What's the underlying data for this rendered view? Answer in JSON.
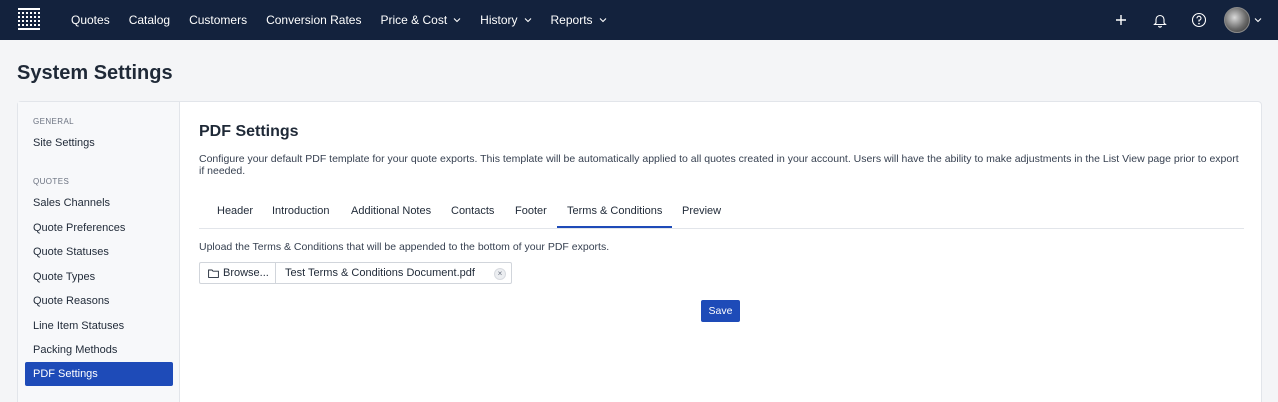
{
  "nav": {
    "items": [
      {
        "label": "Quotes",
        "dropdown": false
      },
      {
        "label": "Catalog",
        "dropdown": false
      },
      {
        "label": "Customers",
        "dropdown": false
      },
      {
        "label": "Conversion Rates",
        "dropdown": false
      },
      {
        "label": "Price & Cost",
        "dropdown": true
      },
      {
        "label": "History",
        "dropdown": true
      },
      {
        "label": "Reports",
        "dropdown": true
      }
    ],
    "right_icons": [
      "plus-icon",
      "bell-icon",
      "help-icon",
      "avatar"
    ]
  },
  "page": {
    "title": "System Settings"
  },
  "sidebar": {
    "sections": [
      {
        "label": "GENERAL",
        "items": [
          "Site Settings"
        ]
      },
      {
        "label": "QUOTES",
        "items": [
          "Sales Channels",
          "Quote Preferences",
          "Quote Statuses",
          "Quote Types",
          "Quote Reasons",
          "Line Item Statuses",
          "Packing Methods",
          "PDF Settings"
        ]
      }
    ],
    "active_item": "PDF Settings"
  },
  "content": {
    "title": "PDF Settings",
    "description": "Configure your default PDF template for your quote exports. This template will be automatically applied to all quotes created in your account. Users will have the ability to make adjustments in the List View page prior to export if needed.",
    "tabs": [
      "Header",
      "Introduction",
      "Additional Notes",
      "Contacts",
      "Footer",
      "Terms & Conditions",
      "Preview"
    ],
    "active_tab": "Terms & Conditions",
    "upload_text": "Upload the Terms & Conditions that will be appended to the bottom of your PDF exports.",
    "browse_label": "Browse...",
    "file_name": "Test Terms & Conditions Document.pdf",
    "clear_label": "×",
    "save_label": "Save"
  },
  "colors": {
    "topbar": "#13223d",
    "accent": "#1e4bb8",
    "background": "#f4f5f7"
  }
}
